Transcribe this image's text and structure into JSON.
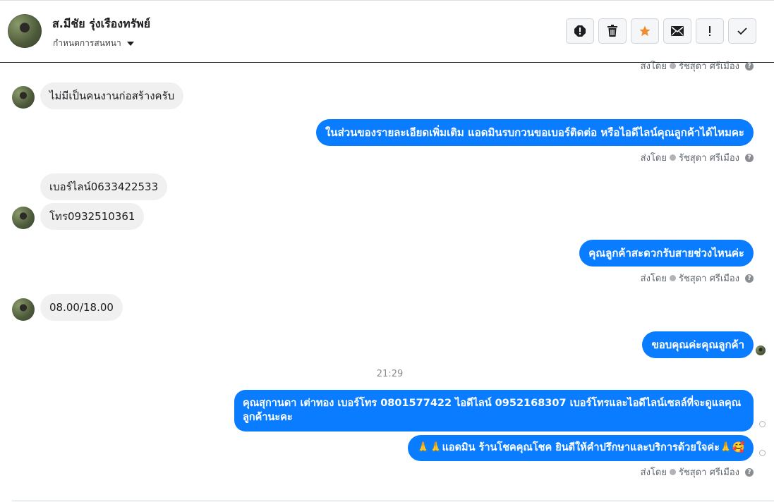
{
  "header": {
    "user_name": "ส.มีชัย รุ่งเรืองทรัพย์",
    "conversation_settings": "กำหนดการสนทนา",
    "toolbar": [
      {
        "name": "spam-icon"
      },
      {
        "name": "trash-icon"
      },
      {
        "name": "star-icon"
      },
      {
        "name": "envelope-icon"
      },
      {
        "name": "important-icon"
      },
      {
        "name": "check-icon"
      }
    ]
  },
  "sent_by": {
    "label": "ส่งโดย",
    "agent": "รัชสุดา ศรีเมือง"
  },
  "messages": {
    "m1": "ไม่มีเป็นคนงานก่อสร้างครับ",
    "m2": "ในส่วนของรายละเอียดเพิ่มเติม แอดมินรบกวนขอเบอร์ติดต่อ หรือไอดีไลน์คุณลูกค้าได้ไหมคะ",
    "m3": "เบอร์ไลน์0633422533",
    "m4": "โทร0932510361",
    "m5": "คุณลูกค้าสะดวกรับสายช่วงไหนค่ะ",
    "m6": "08.00/18.00",
    "m7": "ขอบคุณค่ะคุณลูกค้า",
    "m8": "คุณสุกานดา เต่าทอง      เบอร์โทร 0801577422  ไอดีไลน์ 0952168307  เบอร์โทรและไอดีไลน์เซลล์ที่จะดูแลคุณลูกค้านะคะ",
    "m9": "🙏🙏แอดมิน ร้านโชคคุณโชค ยินดีให้คำปรึกษาและบริการด้วยใจค่ะ🙏🥰"
  },
  "timestamp": "21:29",
  "colors": {
    "outgoing_bubble": "#0a7cff",
    "incoming_bubble": "#f0f0f0",
    "star": "#f28a2e"
  }
}
